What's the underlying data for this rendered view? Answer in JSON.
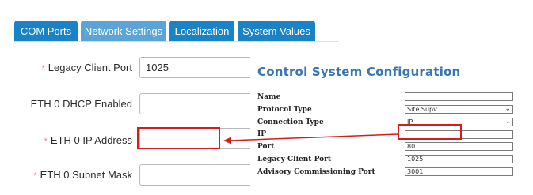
{
  "tabs": [
    {
      "label": "COM Ports",
      "state": "active"
    },
    {
      "label": "Network Settings",
      "state": "inactive"
    },
    {
      "label": "Localization",
      "state": "active"
    },
    {
      "label": "System Values",
      "state": "active"
    }
  ],
  "form": {
    "legacy_client_port": {
      "label": "Legacy Client Port",
      "value": "1025",
      "required": true
    },
    "eth0_dhcp": {
      "label": "ETH 0 DHCP Enabled",
      "value": "",
      "required": false
    },
    "eth0_ip": {
      "label": "ETH 0 IP Address",
      "value": "",
      "required": true
    },
    "eth0_subnet": {
      "label": "ETH 0 Subnet Mask",
      "value": "",
      "required": true
    },
    "required_marker": "*"
  },
  "overlay": {
    "title": "Control System Configuration",
    "rows": [
      {
        "label": "Name",
        "value": "",
        "type": "text"
      },
      {
        "label": "Protocol Type",
        "value": "Site Supv",
        "type": "select"
      },
      {
        "label": "Connection Type",
        "value": "IP",
        "type": "select"
      },
      {
        "label": "IP",
        "value": "",
        "type": "text"
      },
      {
        "label": "Port",
        "value": "80",
        "type": "text"
      },
      {
        "label": "Legacy Client Port",
        "value": "1025",
        "type": "text"
      },
      {
        "label": "Advisory Commissioning Port",
        "value": "3001",
        "type": "text"
      }
    ]
  },
  "colors": {
    "tab_active": "#1a82c6",
    "tab_inactive": "#5aa4d8",
    "title_blue": "#3576b3",
    "highlight_red": "#d41d1d"
  },
  "icons": {
    "select_chevron": "chevron-down-icon",
    "annotation_arrow": "arrow-left-icon"
  }
}
